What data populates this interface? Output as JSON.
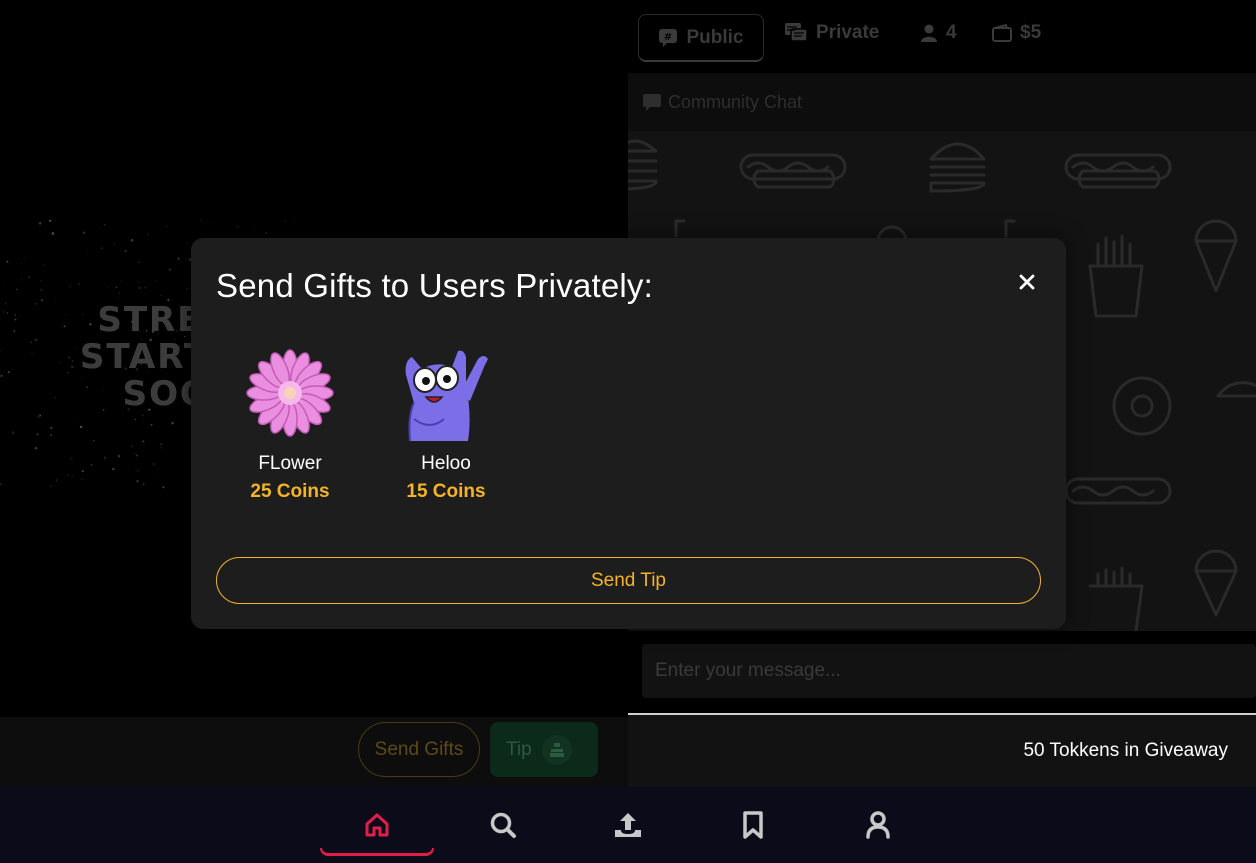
{
  "video": {
    "stream_text_lines": [
      "STREAM",
      "STARTING",
      "SOON"
    ],
    "send_gifts_label": "Send Gifts",
    "tip_label": "Tip"
  },
  "chat": {
    "tabs": {
      "public": "Public",
      "private": "Private",
      "viewer_count": "4",
      "wallet_balance": "$5"
    },
    "header_title": "Community Chat",
    "input_placeholder": "Enter your message...",
    "giveaway_text": "50 Tokkens in Giveaway"
  },
  "modal": {
    "title": "Send Gifts to Users Privately:",
    "gifts": [
      {
        "name": "FLower",
        "price": "25 Coins",
        "icon": "flower-icon"
      },
      {
        "name": "Heloo",
        "price": "15 Coins",
        "icon": "waving-cat-icon"
      }
    ],
    "send_tip_label": "Send Tip",
    "close_icon": "close-icon"
  },
  "bottom_nav": {
    "items": [
      {
        "icon": "home-icon",
        "active": true
      },
      {
        "icon": "search-icon",
        "active": false
      },
      {
        "icon": "upload-icon",
        "active": false
      },
      {
        "icon": "bookmark-icon",
        "active": false
      },
      {
        "icon": "profile-icon",
        "active": false
      }
    ]
  },
  "colors": {
    "accent_gold": "#f5b32a",
    "active_nav": "#e11d48",
    "modal_bg": "#1d1d1d",
    "nav_bg": "#0b0b1a"
  }
}
